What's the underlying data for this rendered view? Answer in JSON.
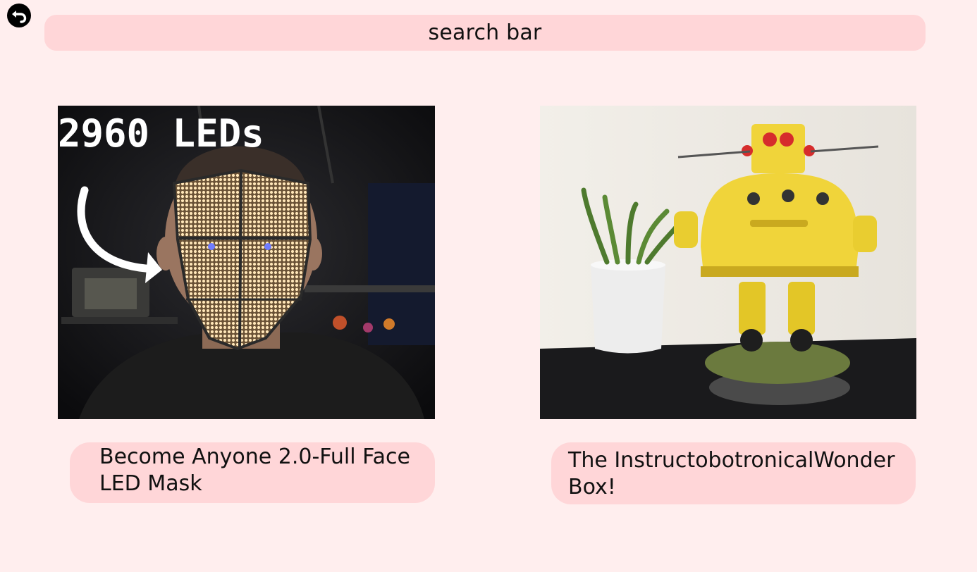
{
  "header": {
    "back_icon": "back-arrow-icon",
    "search": {
      "label": "search bar"
    }
  },
  "projects": [
    {
      "title": "Become Anyone 2.0-Full Face LED Mask",
      "image_caption": "2960 LEDs",
      "image_subject": "led-mask-photo"
    },
    {
      "title": "The InstructobotronicalWonder Box!",
      "image_subject": "yellow-robot-photo"
    }
  ],
  "colors": {
    "background": "#ffeeee",
    "pill": "#ffd6d8",
    "text": "#111111"
  }
}
